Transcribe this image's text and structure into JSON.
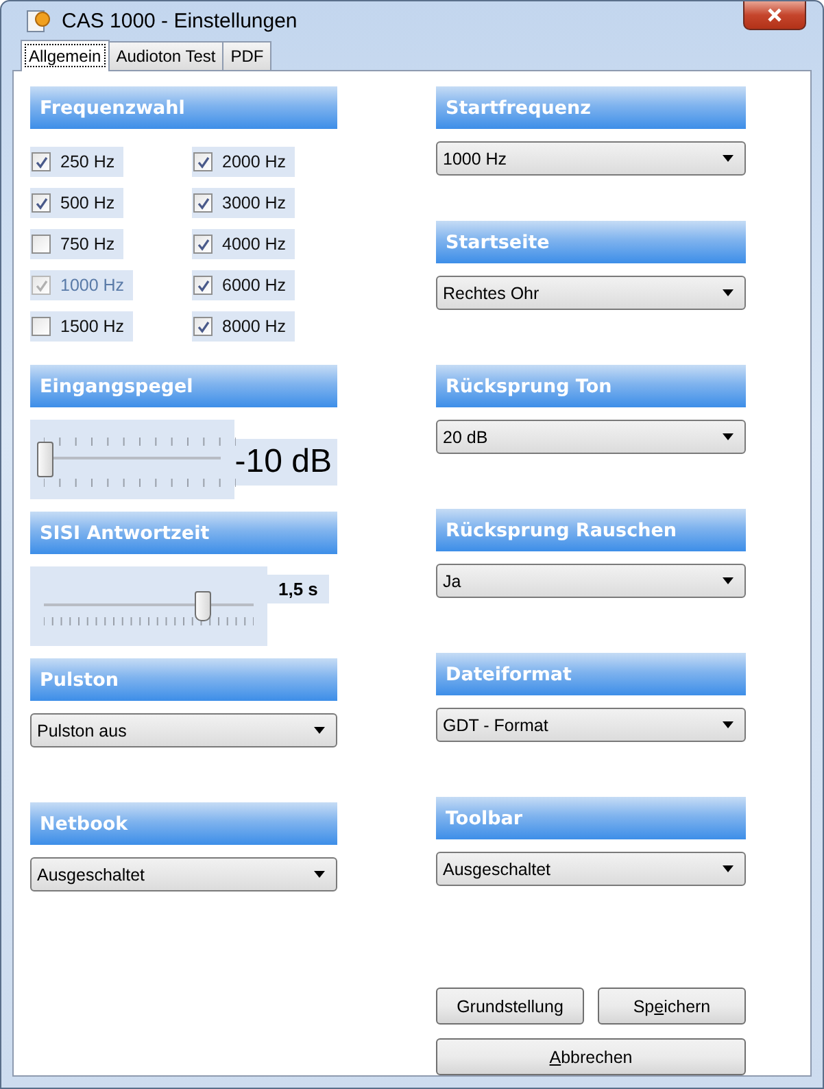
{
  "window": {
    "title": "CAS 1000 - Einstellungen"
  },
  "tabs": [
    {
      "label": "Allgemein",
      "selected": true
    },
    {
      "label": "Audioton Test",
      "selected": false
    },
    {
      "label": "PDF",
      "selected": false
    }
  ],
  "left_sections": [
    {
      "kind": "checkboxes",
      "title": "Frequenzwahl",
      "columns": [
        [
          {
            "label": "250 Hz",
            "checked": true,
            "disabled": false
          },
          {
            "label": "500 Hz",
            "checked": true,
            "disabled": false
          },
          {
            "label": "750 Hz",
            "checked": false,
            "disabled": false
          },
          {
            "label": "1000 Hz",
            "checked": true,
            "disabled": true
          },
          {
            "label": "1500 Hz",
            "checked": false,
            "disabled": false
          }
        ],
        [
          {
            "label": "2000 Hz",
            "checked": true,
            "disabled": false
          },
          {
            "label": "3000 Hz",
            "checked": true,
            "disabled": false
          },
          {
            "label": "4000 Hz",
            "checked": true,
            "disabled": false
          },
          {
            "label": "6000 Hz",
            "checked": true,
            "disabled": false
          },
          {
            "label": "8000 Hz",
            "checked": true,
            "disabled": false
          }
        ]
      ]
    },
    {
      "kind": "slider",
      "title": "Eingangspegel",
      "level": 0,
      "reading": "-10 dB"
    },
    {
      "kind": "trackbar",
      "title": "SISI Antwortzeit",
      "level": 0.75,
      "reading": "1,5 s"
    },
    {
      "kind": "dropdown",
      "title": "Pulston",
      "value": "Pulston aus"
    },
    {
      "kind": "dropdown",
      "title": "Netbook",
      "value": "Ausgeschaltet"
    }
  ],
  "right_sections": [
    {
      "kind": "dropdown",
      "title": "Startfrequenz",
      "value": "1000 Hz"
    },
    {
      "kind": "dropdown",
      "title": "Startseite",
      "value": "Rechtes Ohr"
    },
    {
      "kind": "dropdown",
      "title": "Rücksprung Ton",
      "value": "20 dB"
    },
    {
      "kind": "dropdown",
      "title": "Rücksprung Rauschen",
      "value": "Ja"
    },
    {
      "kind": "dropdown",
      "title": "Dateiformat",
      "value": "GDT - Format"
    },
    {
      "kind": "dropdown",
      "title": "Toolbar",
      "value": "Ausgeschaltet"
    }
  ],
  "buttons": [
    {
      "after": "Grundstellung"
    },
    {
      "before": "Sp",
      "key": "e",
      "after": "ichern"
    },
    {
      "key": "A",
      "after": "bbrechen"
    }
  ]
}
